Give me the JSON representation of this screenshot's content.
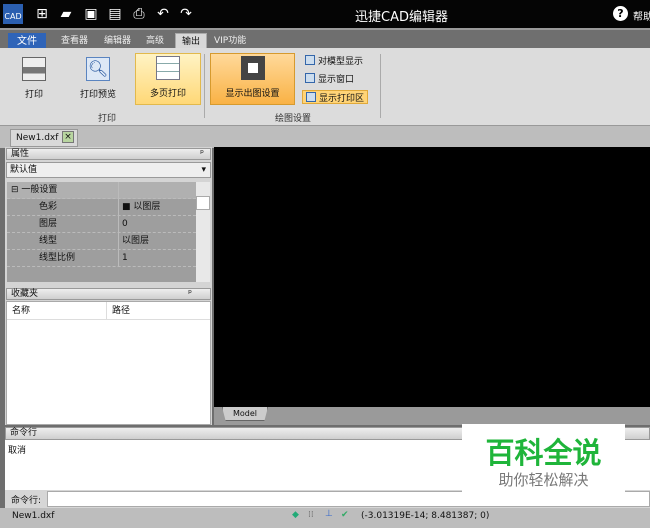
{
  "app": {
    "title": "迅捷CAD编辑器",
    "help": "帮助",
    "logo": "CAD"
  },
  "menu_tabs": [
    {
      "label": "文件"
    },
    {
      "label": "查看器"
    },
    {
      "label": "编辑器"
    },
    {
      "label": "高级"
    },
    {
      "label": "输出"
    },
    {
      "label": "VIP功能"
    }
  ],
  "ribbon": {
    "print": "打印",
    "print_preview": "打印预览",
    "multi_print": "多页打印",
    "group_print": "打印",
    "show_plot_settings": "显示出图设置",
    "model_display": "对模型显示",
    "show_window": "显示窗口",
    "show_print_area": "显示打印区",
    "group_plot": "绘图设置"
  },
  "doc_tab": "New1.dxf",
  "properties": {
    "title": "属性",
    "dropdown": "默认值",
    "section": "一般设置",
    "rows": [
      {
        "k": "色彩",
        "v": "以图层"
      },
      {
        "k": "图层",
        "v": "0"
      },
      {
        "k": "线型",
        "v": "以图层"
      },
      {
        "k": "线型比例",
        "v": "1"
      }
    ]
  },
  "favorites": {
    "title": "收藏夹",
    "col_name": "名称",
    "col_path": "路径"
  },
  "model_tab": "Model",
  "command": {
    "title": "命令行",
    "output": "取消",
    "prompt": "命令行:",
    "value": ""
  },
  "status": {
    "file": "New1.dxf",
    "coords": "(-3.01319E-14; 8.481387; 0)"
  },
  "watermark": {
    "title": "百科全说",
    "subtitle": "助你轻松解决",
    "color": "#1fb53a"
  }
}
